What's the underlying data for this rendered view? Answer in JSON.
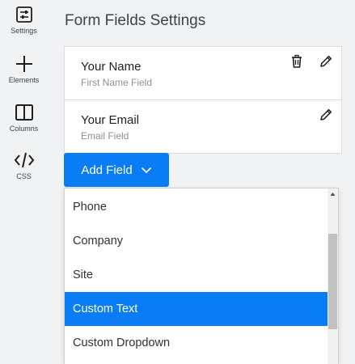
{
  "sidebar": {
    "items": [
      {
        "label": "Settings",
        "icon": "settings-sliders-icon"
      },
      {
        "label": "Elements",
        "icon": "plus-icon"
      },
      {
        "label": "Columns",
        "icon": "columns-icon"
      },
      {
        "label": "CSS",
        "icon": "code-icon"
      }
    ]
  },
  "panel": {
    "title": "Form Fields Settings",
    "fields": [
      {
        "name": "Your Name",
        "subtitle": "First Name Field",
        "actions": [
          "trash-icon",
          "pencil-icon"
        ]
      },
      {
        "name": "Your Email",
        "subtitle": "Email Field",
        "actions": [
          "pencil-icon"
        ]
      }
    ],
    "add_button": {
      "label": "Add Field",
      "icon": "chevron-down-icon"
    }
  },
  "dropdown": {
    "options": [
      "Phone",
      "Company",
      "Site",
      "Custom Text",
      "Custom Dropdown"
    ],
    "selected": "Custom Text"
  },
  "colors": {
    "accent": "#0a7cf5",
    "panel_bg": "#f1f2f3",
    "text_primary": "#3c434a",
    "text_muted": "#8c8f94"
  }
}
